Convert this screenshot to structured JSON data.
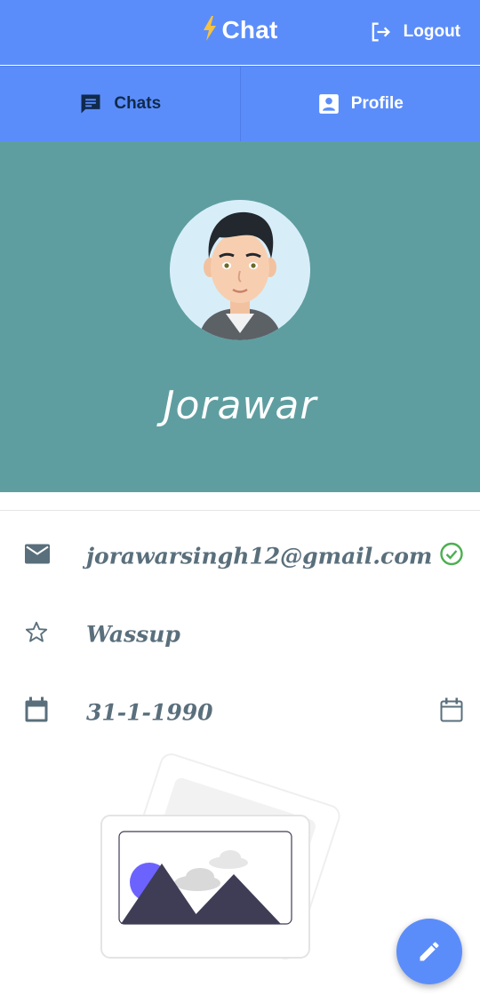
{
  "appbar": {
    "title": "Chat",
    "logout_label": "Logout"
  },
  "tabs": [
    {
      "label": "Chats",
      "icon": "chat-icon"
    },
    {
      "label": "Profile",
      "icon": "profile-icon"
    }
  ],
  "profile": {
    "name": "Jorawar",
    "email": "jorawarsingh12@gmail.com",
    "status": "Wassup",
    "birthday": "31-1-1990"
  },
  "colors": {
    "primary": "#5b8dfa",
    "header_bg": "#5f9ea0",
    "text": "#5a6f7c",
    "verified": "#4caf50"
  }
}
